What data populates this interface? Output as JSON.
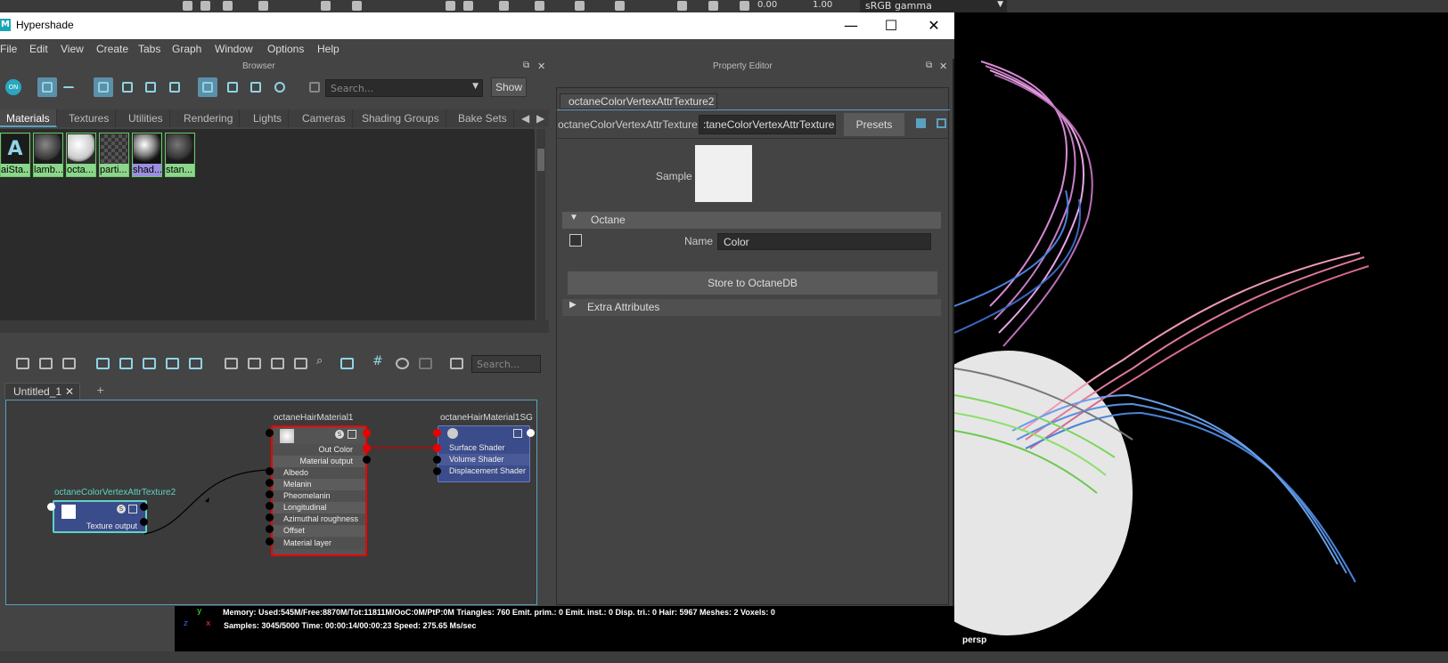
{
  "maya_toolbar": {
    "value1": "0.00",
    "value2": "1.00",
    "gamma": "sRGB gamma"
  },
  "window": {
    "title": "Hypershade"
  },
  "menu": [
    "File",
    "Edit",
    "View",
    "Create",
    "Tabs",
    "Graph",
    "Window",
    "Options",
    "Help"
  ],
  "browser": {
    "title": "Browser",
    "search_placeholder": "Search...",
    "show_label": "Show",
    "tabs": [
      "Materials",
      "Textures",
      "Utilities",
      "Rendering",
      "Lights",
      "Cameras",
      "Shading Groups",
      "Bake Sets"
    ],
    "swatches": [
      "aiSta...",
      "lamb...",
      "octa...",
      "parti...",
      "shad...",
      "stan..."
    ]
  },
  "graph": {
    "search_placeholder": "Search...",
    "tab": "Untitled_1",
    "add_tab": "+",
    "nodes": {
      "vertex": {
        "title": "octaneColorVertexAttrTexture2",
        "output": "Texture output"
      },
      "hair": {
        "title": "octaneHairMaterial1",
        "out_color": "Out Color",
        "material_output": "Material output",
        "inputs": [
          "Albedo",
          "Melanin",
          "Pheomelanin",
          "Longitudinal roughness",
          "Azimuthal roughness",
          "Offset",
          "Material layer"
        ]
      },
      "sg": {
        "title": "octaneHairMaterial1SG",
        "inputs": [
          "Surface Shader",
          "Volume Shader",
          "Displacement Shader"
        ]
      }
    }
  },
  "property_editor": {
    "title": "Property Editor",
    "tab": "octaneColorVertexAttrTexture2",
    "type_label": "octaneColorVertexAttrTexture:",
    "node_name": ":taneColorVertexAttrTexture2",
    "presets": "Presets",
    "sample": "Sample",
    "section": "Octane",
    "name_label": "Name",
    "name_value": "Color",
    "store_button": "Store to OctaneDB",
    "extra": "Extra Attributes"
  },
  "hud": {
    "line1": "Memory: Used:545M/Free:8870M/Tot:11811M/OoC:0M/PtP:0M Triangles: 760 Emit. prim.: 0 Emit. inst.: 0 Disp. tri.: 0 Hair: 5967 Meshes: 2 Voxels: 0",
    "line2": "Samples: 3045/5000 Time: 00:00:14/00:00:23 Speed: 275.65 Ms/sec",
    "camera": "persp",
    "axis_y": "y",
    "axis_x": "x",
    "axis_z": "z"
  }
}
